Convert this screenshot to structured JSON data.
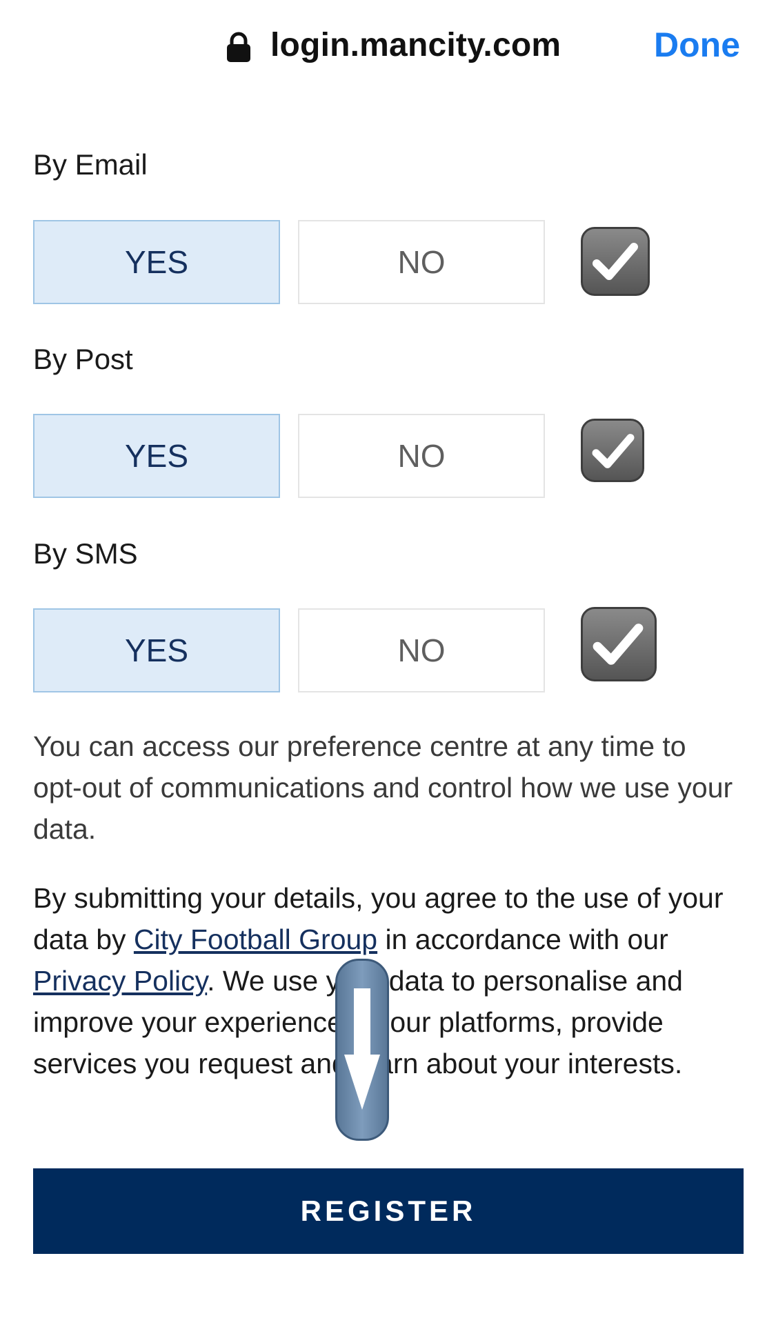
{
  "topbar": {
    "url": "login.mancity.com",
    "done_label": "Done",
    "lock_icon": "lock-icon"
  },
  "preferences": [
    {
      "label": "By Email",
      "yes": "YES",
      "no": "NO",
      "selected": "YES",
      "checked": true
    },
    {
      "label": "By Post",
      "yes": "YES",
      "no": "NO",
      "selected": "YES",
      "checked": true
    },
    {
      "label": "By SMS",
      "yes": "YES",
      "no": "NO",
      "selected": "YES",
      "checked": true
    }
  ],
  "info": {
    "preference_text": "You can access our preference centre at any time to opt-out of communications and control how we use your data.",
    "agree_part1": "By submitting your details, you agree to the use of your data by ",
    "cfg_link": "City Football Group",
    "agree_part2": " in accordance with our ",
    "privacy_link": "Privacy Policy",
    "agree_part3": ". We use your data to personalise and improve your experience on our platforms, provide services you request and learn about your interests."
  },
  "register_label": "REGISTER",
  "colors": {
    "accent": "#1a7cf0",
    "navy": "#002a5c",
    "yes_bg": "#deebf8"
  }
}
